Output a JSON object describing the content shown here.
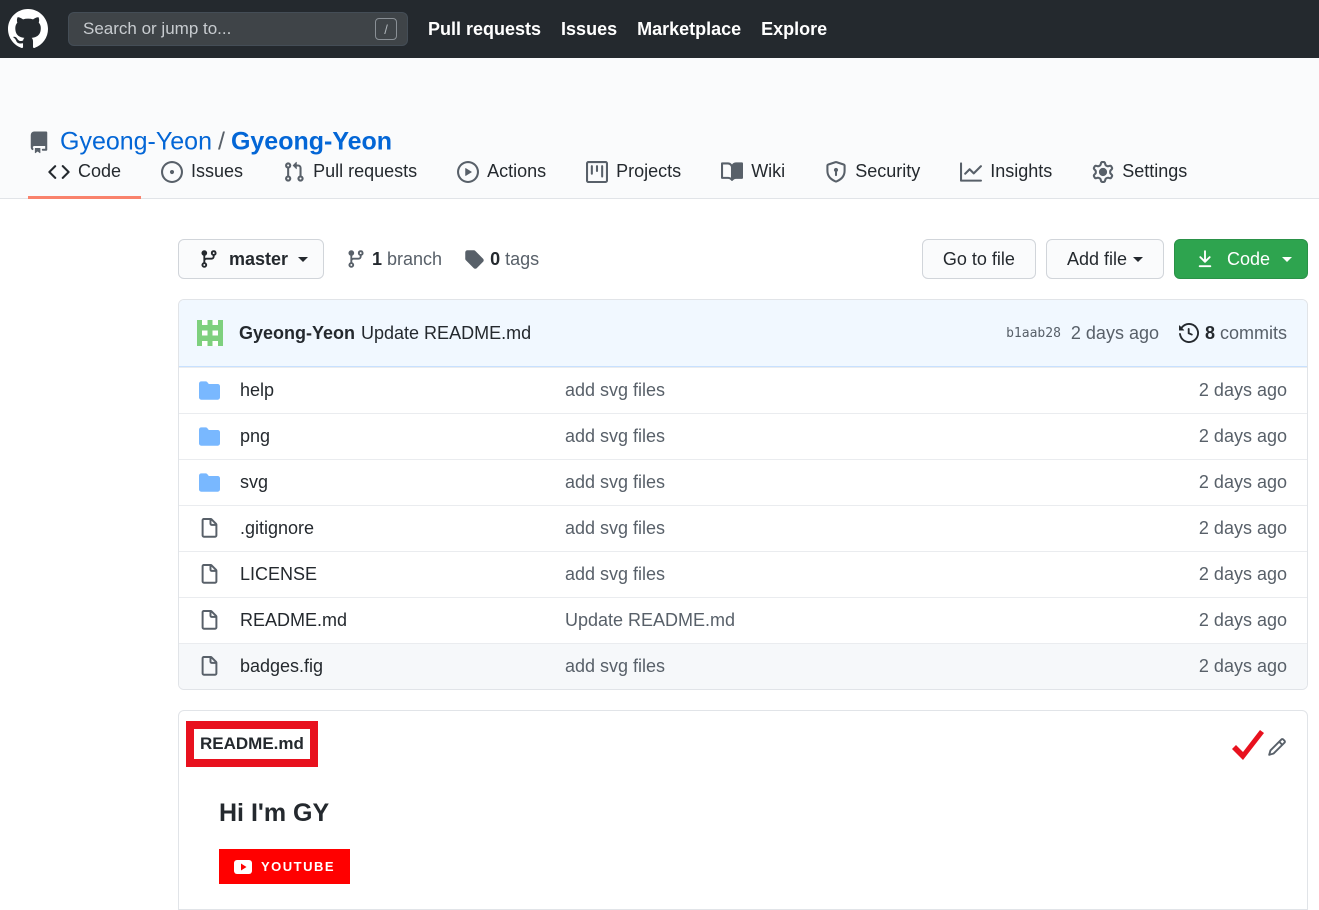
{
  "topbar": {
    "search_placeholder": "Search or jump to...",
    "search_shortcut": "/",
    "nav": [
      "Pull requests",
      "Issues",
      "Marketplace",
      "Explore"
    ]
  },
  "repo": {
    "owner": "Gyeong-Yeon",
    "separator": "/",
    "name": "Gyeong-Yeon"
  },
  "tabs": [
    {
      "label": "Code",
      "icon": "code-icon",
      "active": true
    },
    {
      "label": "Issues",
      "icon": "issue-icon"
    },
    {
      "label": "Pull requests",
      "icon": "pull-request-icon"
    },
    {
      "label": "Actions",
      "icon": "play-icon"
    },
    {
      "label": "Projects",
      "icon": "project-icon"
    },
    {
      "label": "Wiki",
      "icon": "book-icon"
    },
    {
      "label": "Security",
      "icon": "shield-icon"
    },
    {
      "label": "Insights",
      "icon": "graph-icon"
    },
    {
      "label": "Settings",
      "icon": "gear-icon"
    }
  ],
  "toolbar": {
    "branch": "master",
    "branch_count": "1",
    "branch_label": "branch",
    "tag_count": "0",
    "tag_label": "tags",
    "go_to_file": "Go to file",
    "add_file": "Add file",
    "code": "Code"
  },
  "commit": {
    "author": "Gyeong-Yeon",
    "message": "Update README.md",
    "sha": "b1aab28",
    "ago": "2 days ago",
    "count": "8",
    "count_label": "commits"
  },
  "files": [
    {
      "name": "help",
      "type": "folder",
      "message": "add svg files",
      "age": "2 days ago"
    },
    {
      "name": "png",
      "type": "folder",
      "message": "add svg files",
      "age": "2 days ago"
    },
    {
      "name": "svg",
      "type": "folder",
      "message": "add svg files",
      "age": "2 days ago"
    },
    {
      "name": ".gitignore",
      "type": "file",
      "message": "add svg files",
      "age": "2 days ago"
    },
    {
      "name": "LICENSE",
      "type": "file",
      "message": "add svg files",
      "age": "2 days ago"
    },
    {
      "name": "README.md",
      "type": "file",
      "message": "Update README.md",
      "age": "2 days ago"
    },
    {
      "name": "badges.fig",
      "type": "file",
      "message": "add svg files",
      "age": "2 days ago"
    }
  ],
  "readme": {
    "title": "README.md",
    "heading": "Hi I'm GY",
    "badge": "YOUTUBE"
  },
  "colors": {
    "topbar": "#24292e",
    "link": "#0366d6",
    "green": "#2ea44f",
    "tab_underline": "#f9826c",
    "folder": "#79b8ff",
    "annotation_red": "#e8111e",
    "youtube_red": "#ff0000"
  }
}
